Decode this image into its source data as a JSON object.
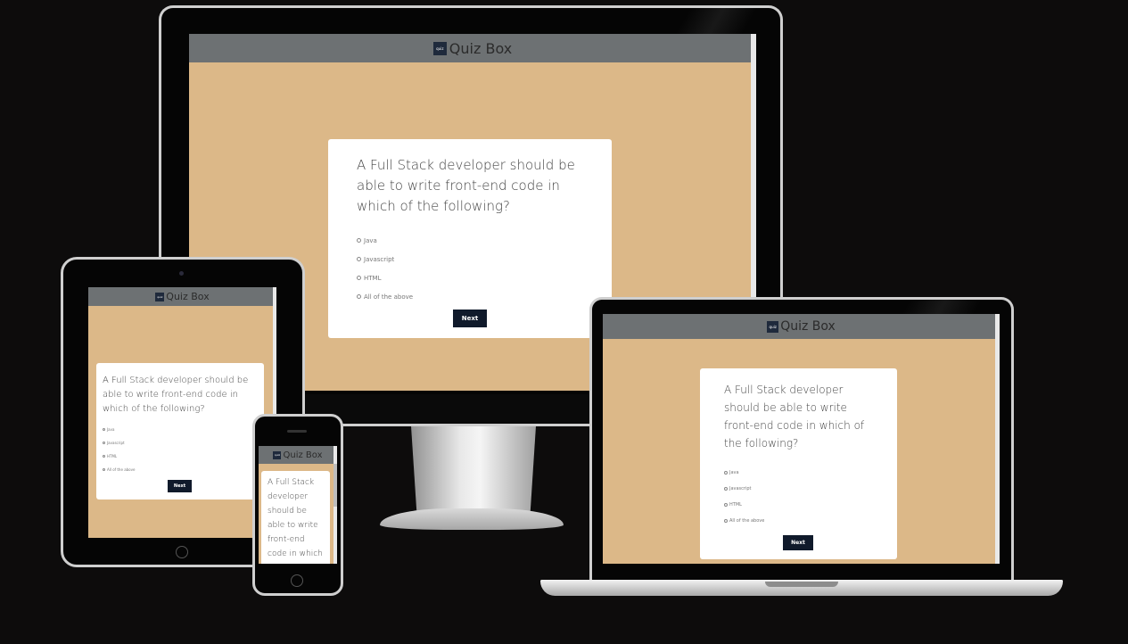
{
  "app": {
    "title": "Quiz Box",
    "logo_text": "quiz"
  },
  "quiz": {
    "question": "A Full Stack developer should be able to write front-end code in which of the following?",
    "options": [
      "Java",
      "Javascript",
      "HTML",
      "All of the above"
    ],
    "next_label": "Next"
  },
  "colors": {
    "page_bg": "#0d0c0c",
    "header_bg": "#6d7173",
    "content_bg": "#dcb888",
    "card_bg": "#ffffff",
    "button_bg": "#101a2b",
    "logo_bg": "#1f2a3c"
  },
  "icons": {
    "logo": "quiz-logo-icon",
    "radio": "radio-unchecked-icon"
  },
  "devices": [
    "desktop-monitor",
    "tablet",
    "phone",
    "laptop"
  ]
}
